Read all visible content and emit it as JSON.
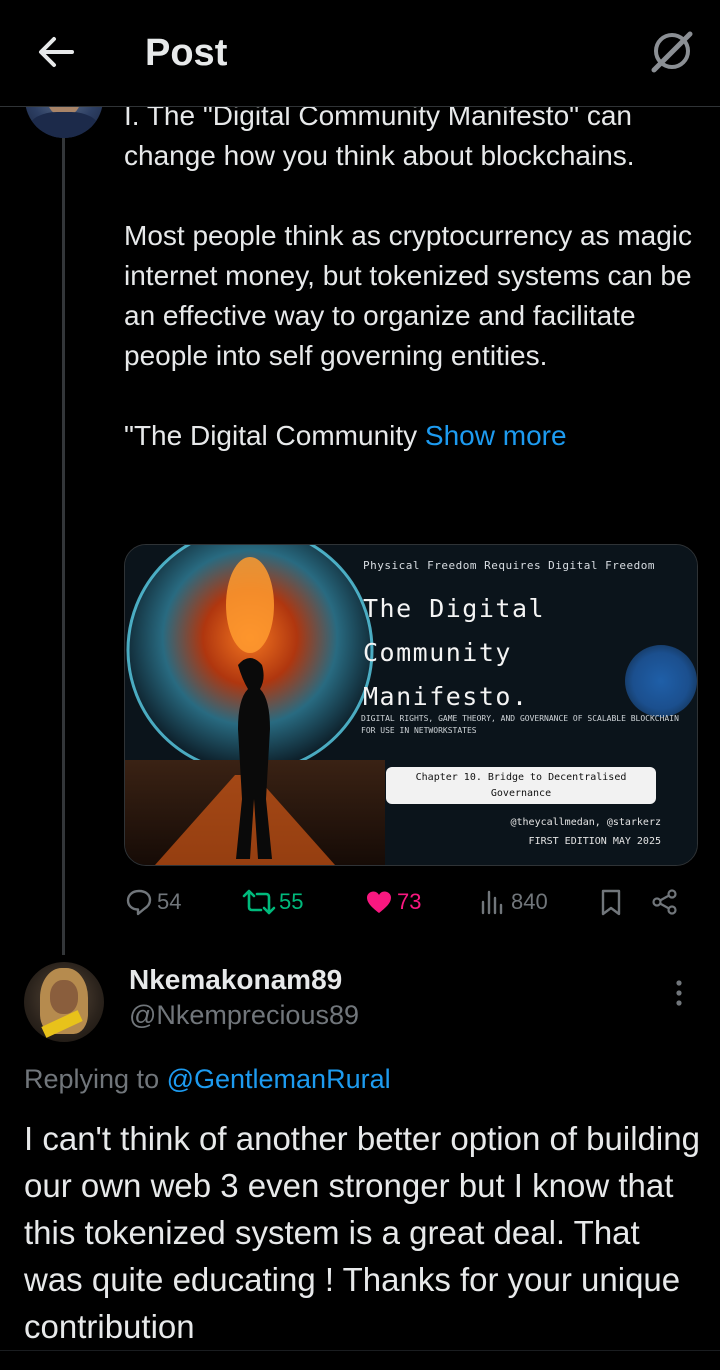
{
  "header": {
    "title": "Post"
  },
  "tweet": {
    "text": "I. The \"Digital Community Manifesto\" can change how you think about blockchains.\n\nMost people think as cryptocurrency as magic internet money, but tokenized systems can be an effective way to organize and facilitate people into self governing entities.\n\n\"The Digital Community ",
    "show_more": "Show more",
    "media": {
      "tagline": "Physical Freedom Requires Digital Freedom",
      "title_line1": "The Digital",
      "title_line2": "Community",
      "title_line3": "Manifesto.",
      "subtitle": "DIGITAL RIGHTS, GAME THEORY, AND GOVERNANCE OF SCALABLE BLOCKCHAIN FOR USE IN NETWORKSTATES",
      "chapter": "Chapter 10. Bridge to Decentralised Governance",
      "authors": "@theycallmedan, @starkerz",
      "edition": "FIRST EDITION MAY 2025"
    },
    "stats": {
      "replies": "54",
      "reposts": "55",
      "likes": "73",
      "views": "840"
    }
  },
  "reply": {
    "display_name": "Nkemakonam89",
    "handle": "@Nkemprecious89",
    "replying_prefix": "Replying to ",
    "replying_to": "@GentlemanRural",
    "text": "I can't think of another better option of building our own web 3 even stronger but I know that this tokenized system is a great deal. That was quite educating ! Thanks for your unique contribution"
  },
  "colors": {
    "accent": "#1d9bf0",
    "repost": "#00ba7c",
    "like": "#f91880",
    "muted": "#71767b",
    "background": "#000000"
  }
}
